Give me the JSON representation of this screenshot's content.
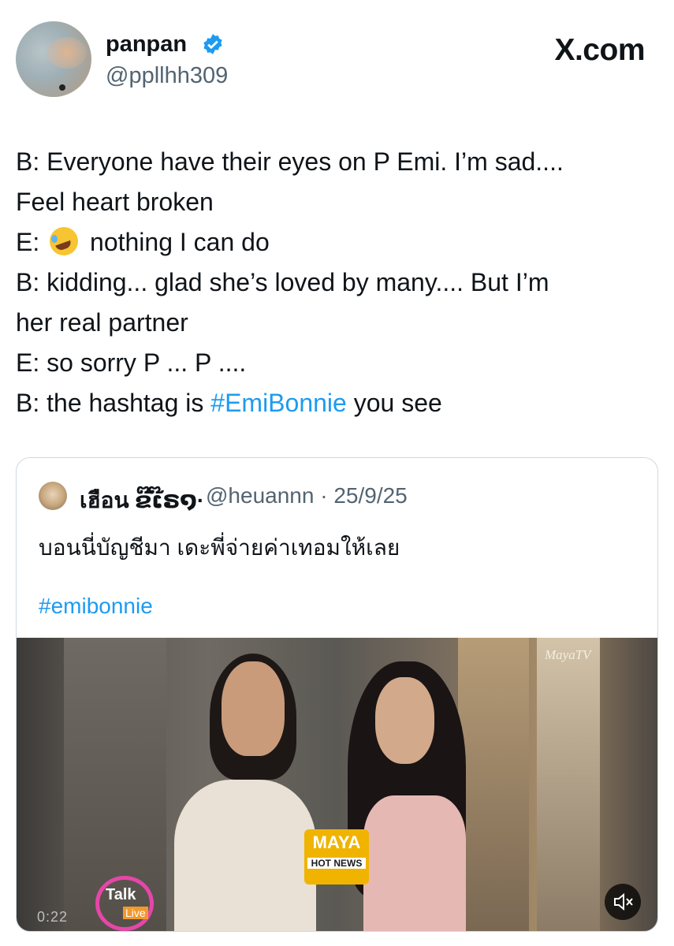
{
  "header": {
    "display_name": "panpan",
    "handle": "@ppllhh309",
    "brand": "X.com",
    "verified_icon": "verified-badge-icon"
  },
  "tweet": {
    "lines": [
      "B: Everyone have their eyes on P Emi. I’m sad....",
      "Feel heart broken",
      "E:",
      "nothing I can do",
      "B: kidding... glad she’s loved by many.... But I’m",
      "her real partner",
      "E: so sorry P ... P ....",
      "B: the hashtag is",
      "#EmiBonnie",
      "you see"
    ]
  },
  "quote": {
    "display_name": "เฮือน ຂ໊ເ໊ຣ໑·",
    "handle": "@heuannn",
    "separator": "·",
    "date": "25/9/25",
    "text": "บอนนี่บัญชีมา เดะพี่จ่ายค่าเทอมให้เลย",
    "hashtag": "#emibonnie"
  },
  "video": {
    "watermark": "MayaTV",
    "maya_logo": "MAYA",
    "maya_sub": "HOT NEWS",
    "talk_logo": "Talk",
    "talk_live": "Live",
    "time": "0:22"
  },
  "colors": {
    "link": "#1d9bf0",
    "secondary_text": "#536471",
    "border": "#cfd9de"
  }
}
